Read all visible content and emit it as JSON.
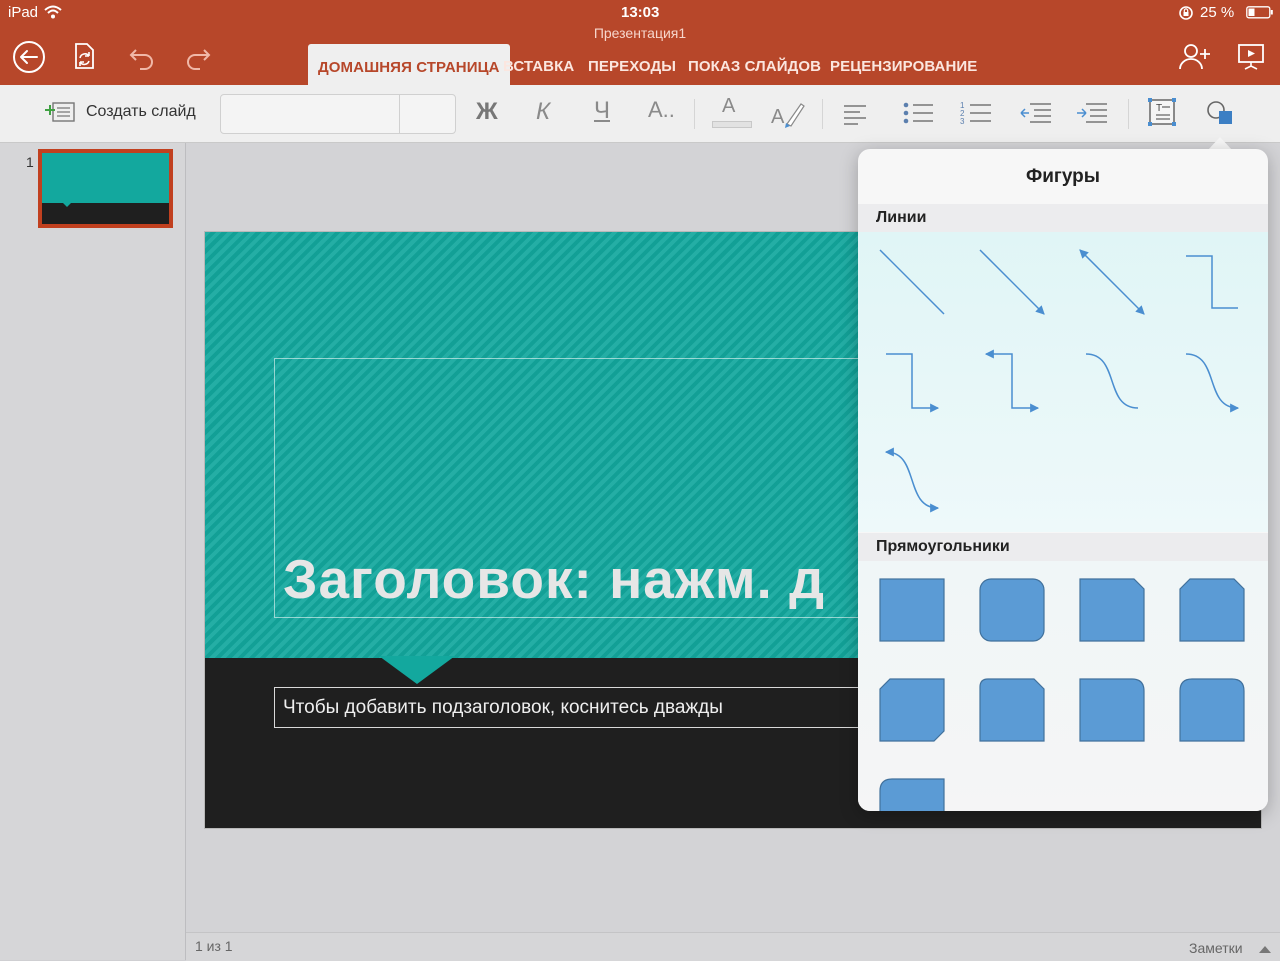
{
  "status": {
    "device": "iPad",
    "time": "13:03",
    "battery": "25 %",
    "icons": [
      "wifi-icon",
      "orientation-lock-icon",
      "battery-icon"
    ]
  },
  "document": {
    "title": "Презентация1"
  },
  "toolbar": {
    "icons": [
      "back-icon",
      "file-sync-icon",
      "undo-icon",
      "redo-icon",
      "share-person-icon",
      "present-icon"
    ]
  },
  "tabs": [
    {
      "label": "ДОМАШНЯЯ СТРАНИЦА",
      "active": true
    },
    {
      "label": "ВСТАВКА"
    },
    {
      "label": "ПЕРЕХОДЫ"
    },
    {
      "label": "ПОКАЗ СЛАЙДОВ"
    },
    {
      "label": "РЕЦЕНЗИРОВАНИЕ"
    }
  ],
  "ribbon": {
    "new_slide": "Создать слайд",
    "font_name": "",
    "font_size": "",
    "bold": "Ж",
    "italic": "К",
    "underline": "Ч",
    "more_format": "А..",
    "font_color": "А"
  },
  "thumbnails": [
    {
      "number": "1"
    }
  ],
  "slide": {
    "title": "Заголовок: нажм. д",
    "subtitle": "Чтобы добавить подзаголовок, коснитесь дважды"
  },
  "bottom": {
    "page_indicator": "1 из 1",
    "notes": "Заметки"
  },
  "popover": {
    "title": "Фигуры",
    "sections": [
      {
        "label": "Линии",
        "shapes": [
          "line",
          "arrow-line",
          "double-arrow-line",
          "elbow-connector",
          "elbow-arrow-connector",
          "elbow-double-arrow-connector",
          "curved-connector",
          "curved-arrow-connector",
          "curved-double-arrow-connector"
        ]
      },
      {
        "label": "Прямоугольники",
        "shapes": [
          "rectangle",
          "rounded-rectangle",
          "snip-single-corner-rectangle",
          "snip-same-side-corner-rectangle",
          "snip-diagonal-corner-rectangle",
          "snip-and-round-single-corner-rectangle",
          "round-single-corner-rectangle",
          "round-same-side-corner-rectangle",
          "round-diagonal-corner-rectangle"
        ]
      }
    ]
  },
  "colors": {
    "brand": "#b7472a",
    "accent_teal": "#13a89e",
    "slide_dark": "#1f1f1f",
    "shape_fill": "#5b9bd5",
    "shape_stroke": "#41719c"
  }
}
